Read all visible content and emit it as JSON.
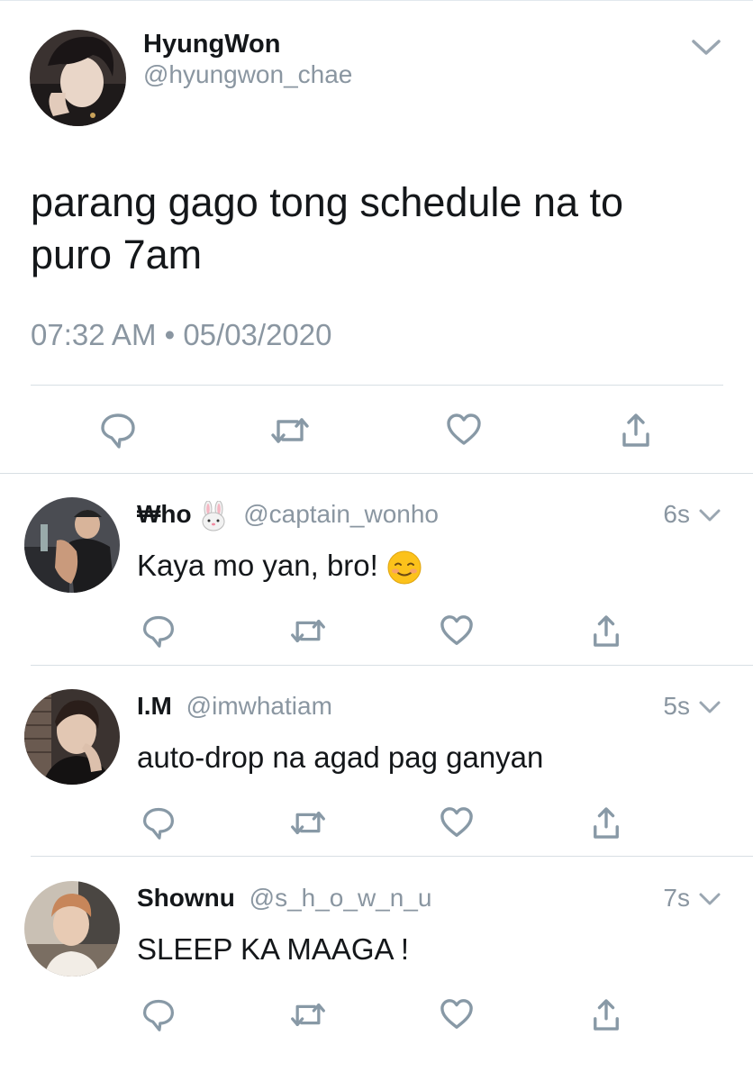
{
  "main_tweet": {
    "display_name": "HyungWon",
    "handle": "@hyungwon_chae",
    "text": "parang gago tong schedule na to puro 7am",
    "timestamp": "07:32 AM • 05/03/2020",
    "avatar_icon": "avatar-photo-hyungwon",
    "actions": [
      "reply-icon",
      "retweet-icon",
      "like-icon",
      "share-icon"
    ]
  },
  "replies": [
    {
      "display_name": "₩ho",
      "name_emoji_icon": "rabbit-face-icon",
      "handle": "@captain_wonho",
      "time": "6s",
      "text": "Kaya mo yan, bro!",
      "text_emoji_icon": "smiling-face-icon",
      "avatar_icon": "avatar-photo-wonho"
    },
    {
      "display_name": "I.M",
      "handle": "@imwhatiam",
      "time": "5s",
      "text": "auto-drop na agad pag ganyan",
      "avatar_icon": "avatar-photo-im"
    },
    {
      "display_name": "Shownu",
      "handle": "@s_h_o_w_n_u",
      "time": "7s",
      "text": "SLEEP KA MAAGA !",
      "avatar_icon": "avatar-photo-shownu"
    }
  ],
  "colors": {
    "primary_text": "#14171a",
    "secondary_text": "#8a96a1",
    "icon": "#8899a6",
    "divider": "#d8dfe4"
  }
}
